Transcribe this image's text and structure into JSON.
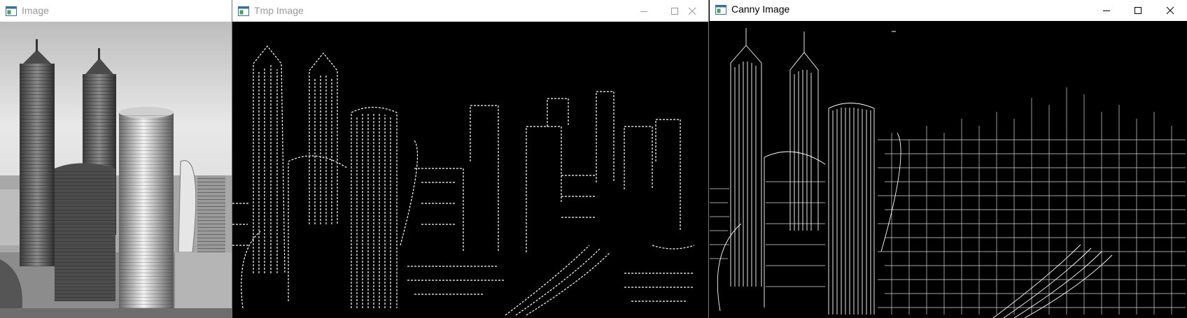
{
  "windows": [
    {
      "title": "Image",
      "icon": "app-window-icon",
      "content": "grayscale-cityscape-photo"
    },
    {
      "title": "Tmp Image",
      "icon": "app-window-icon",
      "content": "edge-detected-cityscape",
      "controls": [
        "minimize-icon",
        "maximize-icon",
        "close-icon"
      ]
    },
    {
      "title": "Canny Image",
      "icon": "app-window-icon",
      "content": "canny-edge-cityscape",
      "controls": [
        "minimize-icon",
        "maximize-icon",
        "close-icon"
      ]
    }
  ],
  "colors": {
    "titlebar": "#ffffff",
    "inactive_title": "#9a9a9a",
    "active_title": "#000000",
    "image_bg": "#000000",
    "edges": "#ffffff"
  }
}
